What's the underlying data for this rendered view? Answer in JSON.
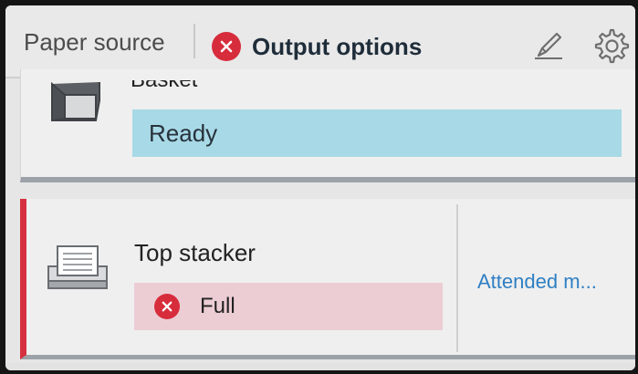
{
  "header": {
    "tabs": [
      {
        "label": "Paper source"
      },
      {
        "label": "Output options",
        "status": "error",
        "selected": true
      }
    ],
    "icons": {
      "edit": "pen-icon",
      "settings": "gear-icon",
      "error": "error-x-icon"
    }
  },
  "bins": {
    "basket": {
      "name": "Basket",
      "status": "Ready",
      "icon": "basket-bin-icon"
    },
    "top_stacker": {
      "name": "Top stacker",
      "status": "Full",
      "action_label": "Attended m...",
      "icon": "stacker-tray-icon"
    }
  },
  "colors": {
    "accent_blue": "#2d6fd1",
    "error_red": "#d72c3b",
    "ready_bg": "#a8d9e6",
    "error_bg": "#eccdd4",
    "link_blue": "#2f7fc3"
  }
}
